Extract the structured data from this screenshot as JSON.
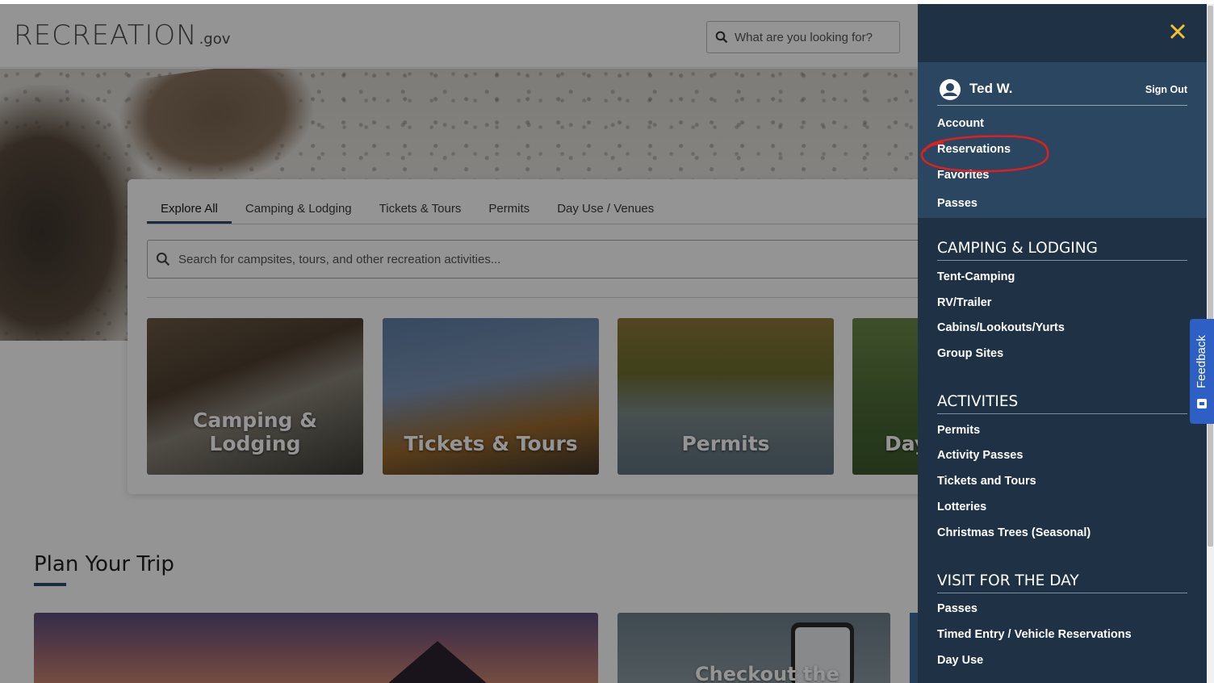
{
  "site": {
    "logo_text": "RECREATION",
    "logo_suffix": ".gov",
    "search_placeholder": "What are you looking for?"
  },
  "explore": {
    "tabs": [
      {
        "label": "Explore All",
        "active": true
      },
      {
        "label": "Camping & Lodging"
      },
      {
        "label": "Tickets & Tours"
      },
      {
        "label": "Permits"
      },
      {
        "label": "Day Use / Venues"
      }
    ],
    "search_placeholder": "Search for campsites, tours, and other recreation activities...",
    "cards": [
      "Camping & Lodging",
      "Tickets & Tours",
      "Permits",
      "Day"
    ]
  },
  "plan": {
    "title": "Plan Your Trip",
    "card2_label": "Checkout the"
  },
  "drawer": {
    "user_name": "Ted W.",
    "sign_out": "Sign Out",
    "account_links": [
      "Account",
      "Reservations",
      "Favorites",
      "Passes"
    ],
    "sections": [
      {
        "title": "CAMPING & LODGING",
        "links": [
          "Tent-Camping",
          "RV/Trailer",
          "Cabins/Lookouts/Yurts",
          "Group Sites"
        ]
      },
      {
        "title": "ACTIVITIES",
        "links": [
          "Permits",
          "Activity Passes",
          "Tickets and Tours",
          "Lotteries",
          "Christmas Trees (Seasonal)"
        ]
      },
      {
        "title": "VISIT FOR THE DAY",
        "links": [
          "Passes",
          "Timed Entry / Vehicle Reservations",
          "Day Use"
        ]
      }
    ]
  },
  "feedback_label": "Feedback",
  "colors": {
    "drawer_bg": "#1f3245",
    "user_box_bg": "#2b4660",
    "close_icon": "#f2c230",
    "annotation_circle": "#e02020",
    "feedback_bg": "#2d5fc4",
    "tab_underline": "#2b4a6a"
  }
}
